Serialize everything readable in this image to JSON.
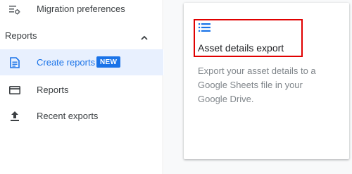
{
  "sidebar": {
    "items": [
      {
        "label": "Migration preferences",
        "icon": "tune-list-icon"
      }
    ],
    "section": {
      "title": "Reports",
      "expanded": true,
      "items": [
        {
          "label": "Create reports",
          "icon": "create-report-icon",
          "badge": "NEW",
          "selected": true
        },
        {
          "label": "Reports",
          "icon": "reports-icon"
        },
        {
          "label": "Recent exports",
          "icon": "export-icon"
        }
      ]
    }
  },
  "main": {
    "card": {
      "icon": "list-icon",
      "title": "Asset details export",
      "description": "Export your asset details to a Google Sheets file in your Google Drive."
    }
  },
  "colors": {
    "accent": "#1a73e8",
    "selected_bg": "#e8f0fe",
    "highlight_border": "#e00000"
  }
}
